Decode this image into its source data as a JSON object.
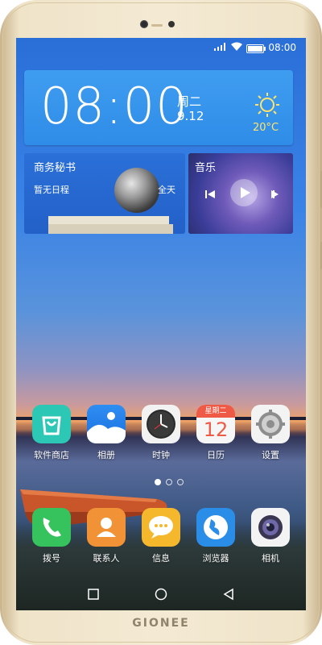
{
  "status_bar": {
    "time": "08:00",
    "battery_percent": 100
  },
  "clock_widget": {
    "time": "08:00",
    "weekday": "周二",
    "date": "9.12",
    "temperature": "20°C"
  },
  "business_widget": {
    "title": "商务秘书",
    "subtitle": "暂无日程",
    "scope": "全天"
  },
  "music_widget": {
    "title": "音乐"
  },
  "apps_row1": [
    {
      "label": "软件商店",
      "icon": "app-store-icon"
    },
    {
      "label": "相册",
      "icon": "gallery-icon"
    },
    {
      "label": "时钟",
      "icon": "clock-icon"
    },
    {
      "label": "日历",
      "icon": "calendar-icon",
      "calendar_header": "星期二",
      "calendar_day": "12"
    },
    {
      "label": "设置",
      "icon": "settings-icon"
    }
  ],
  "apps_dock": [
    {
      "label": "拨号",
      "icon": "phone-icon"
    },
    {
      "label": "联系人",
      "icon": "contacts-icon"
    },
    {
      "label": "信息",
      "icon": "messages-icon"
    },
    {
      "label": "浏览器",
      "icon": "browser-icon"
    },
    {
      "label": "相机",
      "icon": "camera-icon"
    }
  ],
  "page_indicator": {
    "pages": 3,
    "current": 1
  },
  "brand": "GIONEE",
  "colors": {
    "widget_blue": "#2f8ce8",
    "temp_yellow": "#ffe36b"
  }
}
